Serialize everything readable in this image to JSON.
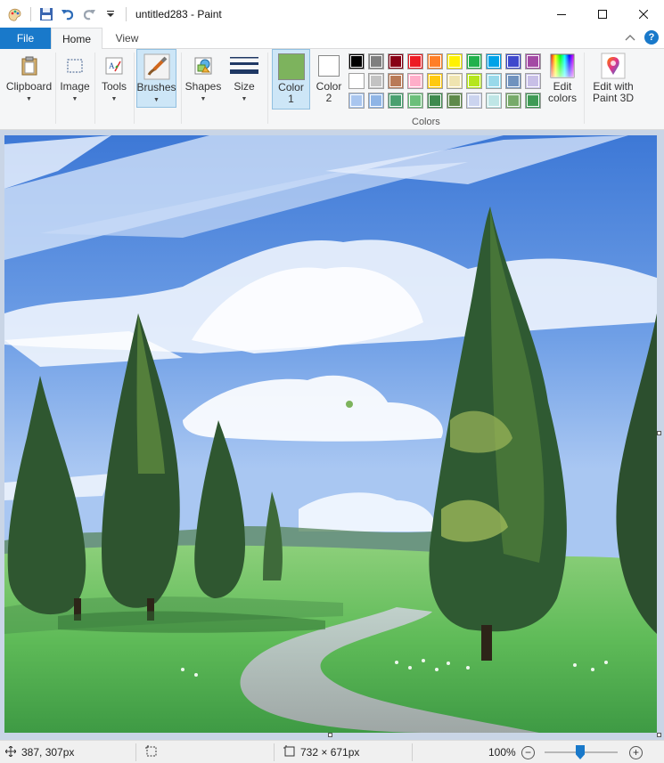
{
  "window": {
    "title": "untitled283 - Paint"
  },
  "tabs": {
    "file": "File",
    "home": "Home",
    "view": "View"
  },
  "ribbon": {
    "clipboard": "Clipboard",
    "image": "Image",
    "tools": "Tools",
    "brushes": "Brushes",
    "shapes": "Shapes",
    "size": "Size",
    "color1_label_line1": "Color",
    "color1_label_line2": "1",
    "color2_label_line1": "Color",
    "color2_label_line2": "2",
    "colors_group": "Colors",
    "edit_colors_line1": "Edit",
    "edit_colors_line2": "colors",
    "paint3d_line1": "Edit with",
    "paint3d_line2": "Paint 3D",
    "color1_value": "#7db35d",
    "color2_value": "#ffffff",
    "palette_row1": [
      "#000000",
      "#7f7f7f",
      "#880015",
      "#ed1c24",
      "#ff7f27",
      "#fff200",
      "#22b14c",
      "#00a2e8",
      "#3f48cc",
      "#a349a4"
    ],
    "palette_row2": [
      "#ffffff",
      "#c3c3c3",
      "#b97a57",
      "#ffaec9",
      "#ffc90e",
      "#efe4b0",
      "#b5e61d",
      "#99d9ea",
      "#7092be",
      "#c8bfe7"
    ],
    "palette_row3": [
      "#a9c6ef",
      "#8fb5e6",
      "#4aa070",
      "#6bbf7a",
      "#3e8a4e",
      "#5e8a4a",
      "#cbd4ef",
      "#bfe6e6",
      "#77aa6a",
      "#3f9a55"
    ]
  },
  "status": {
    "cursor_pos": "387, 307px",
    "image_size": "732 × 671px",
    "zoom": "100%"
  }
}
